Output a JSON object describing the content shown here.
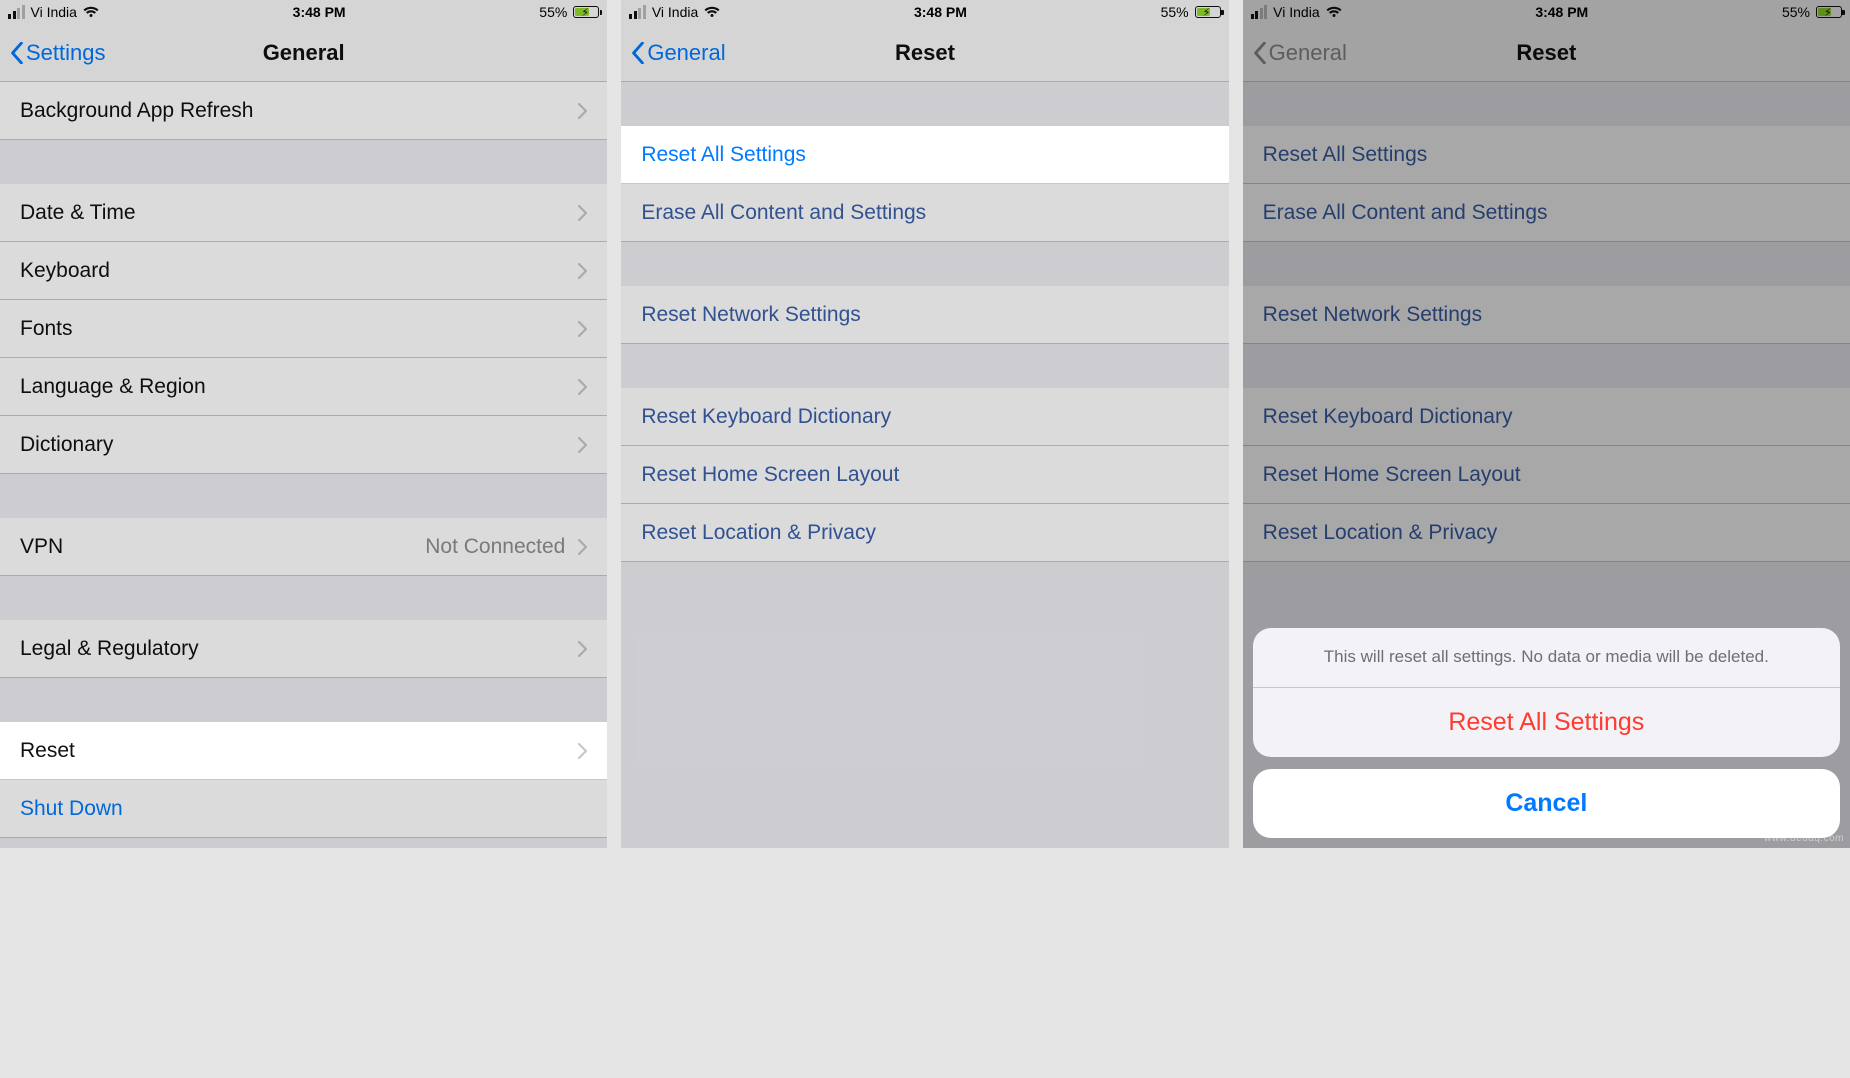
{
  "status": {
    "carrier": "Vi India",
    "time": "3:48 PM",
    "battery_pct": "55%"
  },
  "screen1": {
    "back_label": "Settings",
    "title": "General",
    "rows": {
      "bg_app_refresh": "Background App Refresh",
      "date_time": "Date & Time",
      "keyboard": "Keyboard",
      "fonts": "Fonts",
      "lang_region": "Language & Region",
      "dictionary": "Dictionary",
      "vpn": "VPN",
      "vpn_detail": "Not Connected",
      "legal": "Legal & Regulatory",
      "reset": "Reset",
      "shutdown": "Shut Down"
    }
  },
  "screen2": {
    "back_label": "General",
    "title": "Reset",
    "rows": {
      "reset_all": "Reset All Settings",
      "erase_all": "Erase All Content and Settings",
      "reset_network": "Reset Network Settings",
      "reset_keyboard": "Reset Keyboard Dictionary",
      "reset_home": "Reset Home Screen Layout",
      "reset_location": "Reset Location & Privacy"
    }
  },
  "screen3": {
    "back_label": "General",
    "title": "Reset",
    "sheet": {
      "message": "This will reset all settings. No data or media will be deleted.",
      "destructive": "Reset All Settings",
      "cancel": "Cancel"
    }
  },
  "watermark": "www.deuaq.com"
}
